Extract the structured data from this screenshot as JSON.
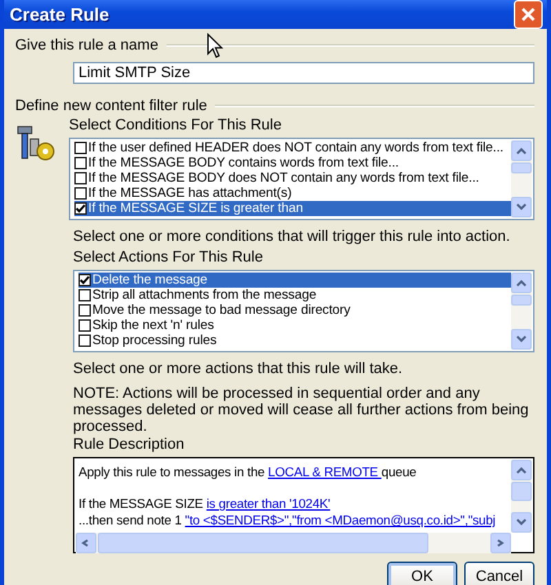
{
  "window": {
    "title": "Create Rule"
  },
  "name_section": {
    "label": "Give this rule a name",
    "value": "Limit SMTP Size"
  },
  "filter_section": {
    "label": "Define new content filter rule"
  },
  "conditions": {
    "label": "Select Conditions For This Rule",
    "hint": "Select one or more conditions that will trigger this rule into action.",
    "items": [
      {
        "label": "If the user defined HEADER does NOT contain any words from text file...",
        "checked": false,
        "selected": false
      },
      {
        "label": "If the MESSAGE BODY contains words from text file...",
        "checked": false,
        "selected": false
      },
      {
        "label": "If the MESSAGE BODY does NOT contain any words from text file...",
        "checked": false,
        "selected": false
      },
      {
        "label": "If the MESSAGE has attachment(s)",
        "checked": false,
        "selected": false
      },
      {
        "label": "If the MESSAGE SIZE is greater than",
        "checked": true,
        "selected": true
      }
    ]
  },
  "actions": {
    "label": "Select Actions For This Rule",
    "hint": "Select one or more actions that this rule will take.",
    "items": [
      {
        "label": "Delete the message",
        "checked": true,
        "selected": true
      },
      {
        "label": "Strip all attachments from the message",
        "checked": false,
        "selected": false
      },
      {
        "label": "Move the message to bad message directory",
        "checked": false,
        "selected": false
      },
      {
        "label": "Skip the next 'n' rules",
        "checked": false,
        "selected": false
      },
      {
        "label": "Stop processing rules",
        "checked": false,
        "selected": false
      }
    ]
  },
  "note": "NOTE:  Actions will be processed in sequential order and any messages deleted or moved will cease all further actions from being processed.",
  "description": {
    "label": "Rule Description",
    "paragraphs": [
      {
        "lines": [
          {
            "parts": [
              {
                "kind": "text",
                "text": "Apply this rule to messages in the "
              },
              {
                "kind": "link",
                "text": "LOCAL & REMOTE "
              },
              {
                "kind": "text",
                "text": " queue"
              }
            ]
          }
        ]
      },
      {
        "lines": [
          {
            "parts": [
              {
                "kind": "text",
                "text": "If the MESSAGE SIZE "
              },
              {
                "kind": "link",
                "text": "is greater than '1024K'"
              }
            ]
          },
          {
            "parts": [
              {
                "kind": "text",
                "text": "...then send note 1 "
              },
              {
                "kind": "link",
                "text": "\"to <$SENDER$>\",\"from <MDaemon@usq.co.id>\",\"subj"
              }
            ]
          }
        ]
      }
    ]
  },
  "buttons": [
    {
      "label": "OK",
      "default": true
    },
    {
      "label": "Cancel",
      "default": false
    }
  ]
}
